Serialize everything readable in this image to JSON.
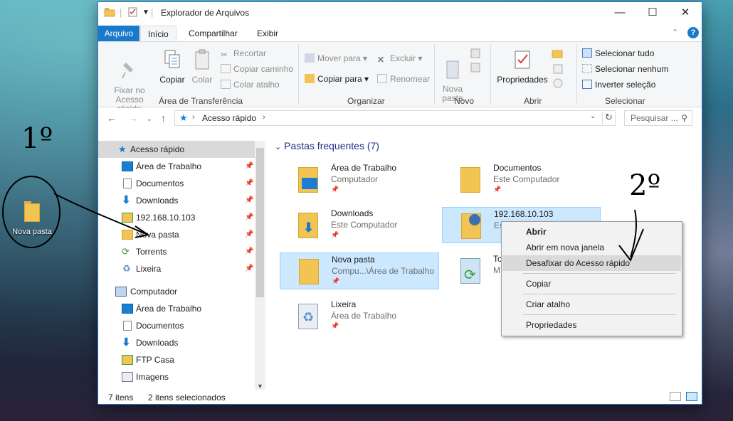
{
  "window": {
    "title": "Explorador de Arquivos",
    "tabs": [
      "Arquivo",
      "Início",
      "Compartilhar",
      "Exibir"
    ]
  },
  "ribbon": {
    "clipboard": {
      "pin": "Fixar no\nAcesso rápido",
      "copy": "Copiar",
      "paste": "Colar",
      "cut": "Recortar",
      "copy_path": "Copiar caminho",
      "paste_shortcut": "Colar atalho",
      "label": "Área de Transferência"
    },
    "organize": {
      "move_to": "Mover para",
      "copy_to": "Copiar para",
      "delete": "Excluir",
      "rename": "Renomear",
      "label": "Organizar"
    },
    "new": {
      "new_folder": "Nova\npasta",
      "label": "Novo"
    },
    "open": {
      "properties": "Propriedades",
      "label": "Abrir"
    },
    "select": {
      "select_all": "Selecionar tudo",
      "select_none": "Selecionar nenhum",
      "invert": "Inverter seleção",
      "label": "Selecionar"
    }
  },
  "address": {
    "path": "Acesso rápido",
    "search_placeholder": "Pesquisar ..."
  },
  "nav": {
    "quick_access": "Acesso rápido",
    "quick_items": [
      "Área de Trabalho",
      "Documentos",
      "Downloads",
      "192.168.10.103",
      "Nova pasta",
      "Torrents",
      "Lixeira"
    ],
    "computer": "Computador",
    "computer_items": [
      "Área de Trabalho",
      "Documentos",
      "Downloads",
      "FTP Casa",
      "Imagens"
    ]
  },
  "content": {
    "group_header": "Pastas frequentes (7)",
    "tiles": [
      {
        "name": "Área de Trabalho",
        "sub": "Computador"
      },
      {
        "name": "Documentos",
        "sub": "Este Computador"
      },
      {
        "name": "Downloads",
        "sub": "Este Computador"
      },
      {
        "name": "192.168.10.103",
        "sub": "Es"
      },
      {
        "name": "Nova pasta",
        "sub": "Compu...\\Área de Trabalho"
      },
      {
        "name": "To",
        "sub": "M"
      },
      {
        "name": "Lixeira",
        "sub": "Área de Trabalho"
      }
    ]
  },
  "context_menu": {
    "items": [
      "Abrir",
      "Abrir em nova janela",
      "Desafixar do Acesso rápido",
      "Copiar",
      "Criar atalho",
      "Propriedades"
    ]
  },
  "status": {
    "count": "7 itens",
    "selected": "2 itens selecionados"
  },
  "desktop": {
    "icon_label": "Nova pasta"
  },
  "annotations": {
    "first": "1º",
    "second": "2º"
  }
}
